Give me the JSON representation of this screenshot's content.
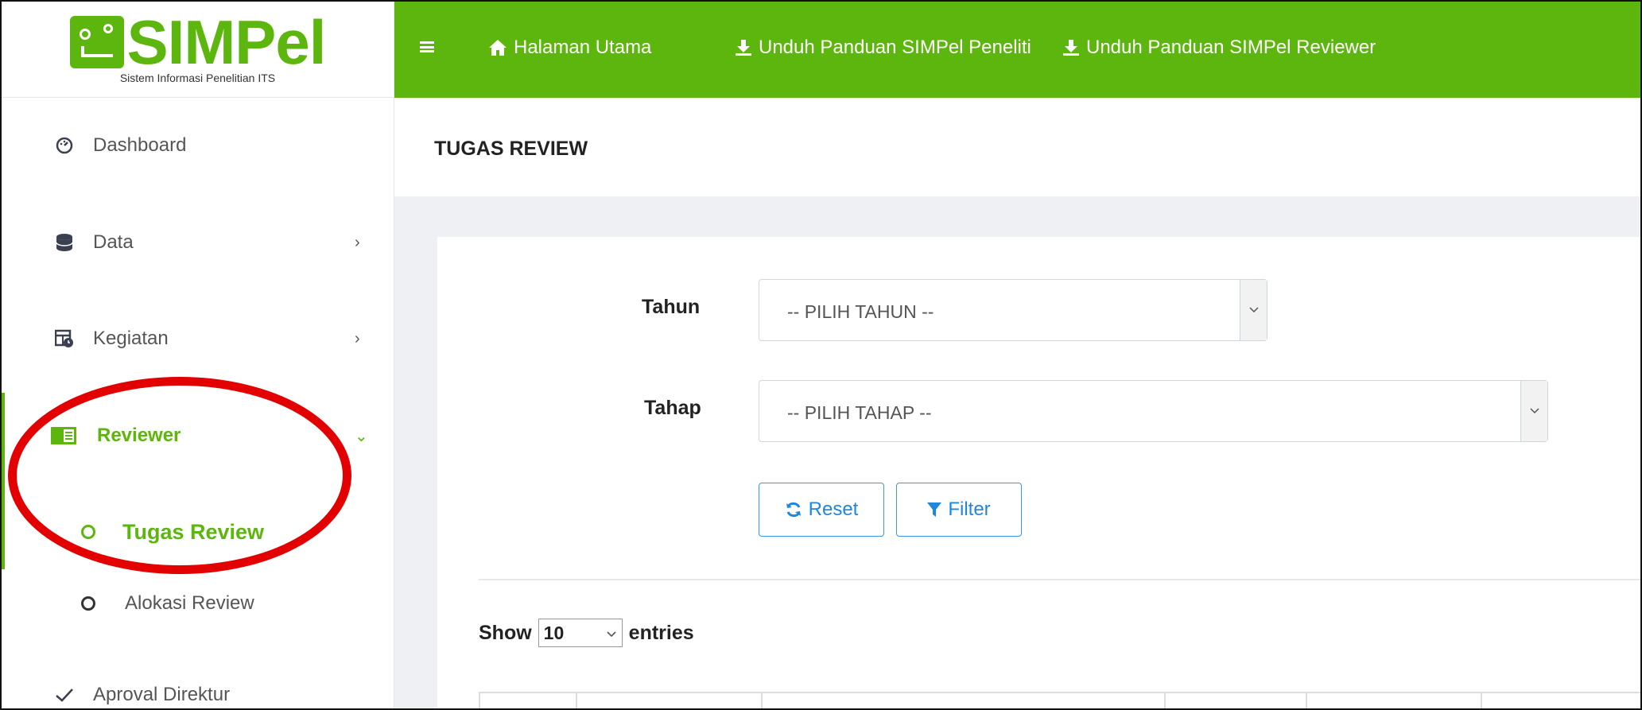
{
  "sidebar": {
    "logo": {
      "title": "SIMPel",
      "subtitle": "Sistem Informasi Penelitian ITS"
    },
    "menu": [
      {
        "label": "Dashboard",
        "icon": "dashboard-icon"
      },
      {
        "label": "Data",
        "icon": "database-icon",
        "arrow": "›"
      },
      {
        "label": "Kegiatan",
        "icon": "calendar-icon",
        "arrow": "›"
      },
      {
        "label": "Reviewer",
        "icon": "book-icon",
        "arrow": "⌄"
      },
      {
        "label": "Aproval Direktur",
        "icon": "check-icon"
      }
    ],
    "submenu": [
      {
        "label": "Tugas Review"
      },
      {
        "label": "Alokasi Review"
      }
    ]
  },
  "topbar": {
    "links": [
      {
        "label": "Halaman Utama",
        "icon": "home-icon"
      },
      {
        "label": "Unduh Panduan SIMPel Peneliti",
        "icon": "download-icon"
      },
      {
        "label": "Unduh Panduan SIMPel Reviewer",
        "icon": "download-icon"
      }
    ]
  },
  "page": {
    "title": "TUGAS REVIEW"
  },
  "filter": {
    "tahun_label": "Tahun",
    "tahun_value": "-- PILIH TAHUN --",
    "tahap_label": "Tahap",
    "tahap_value": "-- PILIH TAHAP --",
    "reset_label": "Reset",
    "filter_label": "Filter"
  },
  "table": {
    "show_label": "Show",
    "entries_value": "10",
    "entries_label": "entries"
  },
  "colors": {
    "brand": "#5db60d",
    "link": "#1f86de",
    "highlight": "#e30000"
  }
}
